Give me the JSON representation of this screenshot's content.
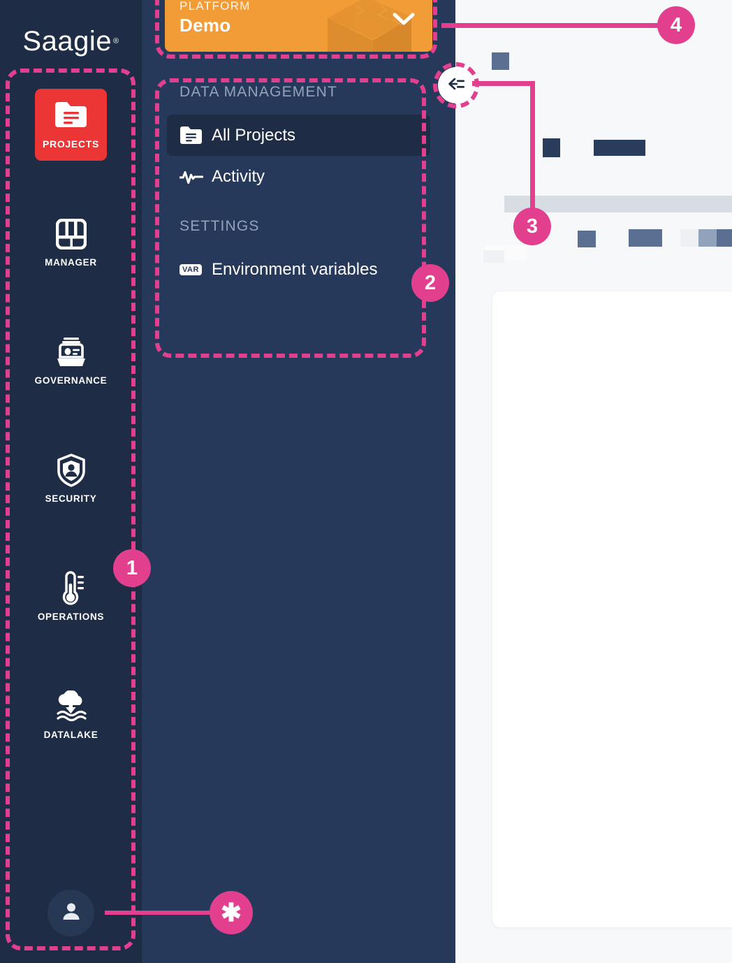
{
  "brand": {
    "name": "Saagie",
    "registered": "®"
  },
  "rail": {
    "items": [
      {
        "label": "PROJECTS",
        "icon": "folder-lines-icon",
        "active": true
      },
      {
        "label": "MANAGER",
        "icon": "grid-panels-icon",
        "active": false
      },
      {
        "label": "GOVERNANCE",
        "icon": "catalog-card-icon",
        "active": false
      },
      {
        "label": "SECURITY",
        "icon": "shield-user-icon",
        "active": false
      },
      {
        "label": "OPERATIONS",
        "icon": "thermometer-icon",
        "active": false
      },
      {
        "label": "DATALAKE",
        "icon": "cloud-download-waves-icon",
        "active": false
      }
    ],
    "user_button": {
      "icon": "user-avatar-icon"
    }
  },
  "platform": {
    "label": "PLATFORM",
    "value": "Demo",
    "chevron_icon": "chevron-down-icon",
    "decor_icon": "3d-box-icon",
    "accent_color": "#f29c38"
  },
  "nav": {
    "sections": [
      {
        "title": "DATA MANAGEMENT",
        "items": [
          {
            "label": "All Projects",
            "icon": "folder-lines-icon",
            "active": true
          },
          {
            "label": "Activity",
            "icon": "pulse-activity-icon",
            "active": false
          }
        ]
      },
      {
        "title": "SETTINGS",
        "items": [
          {
            "label": "Environment variables",
            "icon": "var-badge-icon",
            "badge": "VAR",
            "active": false
          }
        ]
      }
    ]
  },
  "collapse": {
    "icon": "collapse-sidebar-arrow-icon"
  },
  "annotations": {
    "accent_color": "#e2408f",
    "markers": [
      {
        "id": "1",
        "label": "1"
      },
      {
        "id": "2",
        "label": "2"
      },
      {
        "id": "3",
        "label": "3"
      },
      {
        "id": "4",
        "label": "4"
      },
      {
        "id": "star",
        "label": "✱"
      }
    ]
  },
  "theme": {
    "rail_bg": "#1e2d45",
    "panel_bg": "#27395a",
    "active_rail_bg": "#ec3535",
    "content_bg": "#f7f8fa",
    "muted_text": "#93a3bd"
  }
}
